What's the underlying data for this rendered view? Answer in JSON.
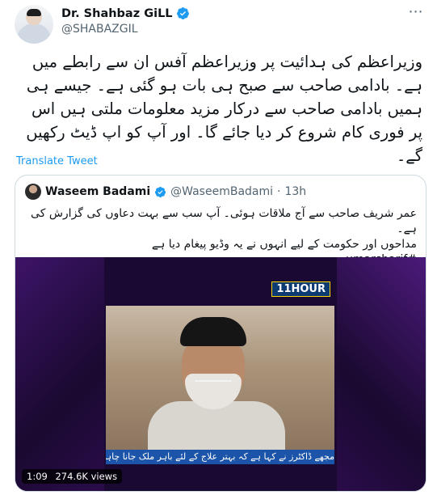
{
  "author": {
    "display_name": "Dr. Shahbaz GiLL",
    "handle": "@SHABAZGIL"
  },
  "tweet": {
    "text": "وزیراعظم کی ہدائیت پر وزیراعظم آفس ان سے رابطے میں ہے۔ بادامی صاحب سے صبح ہی بات ہو گئی ہے۔  جیسے ہی ہمیں بادامی صاحب سے درکار  مزید معلومات ملتی ہیں اس پر فوری کام شروع کر دیا جائے گا۔ اور آپ کو اپ ڈیٹ رکھیں گے۔",
    "translate_label": "Translate Tweet"
  },
  "quoted": {
    "display_name": "Waseem Badami",
    "handle": "@WaseemBadami",
    "separator": "·",
    "time": "13h",
    "text_line1": "عمر شریف صاحب سے آج ملاقات ہوئی۔ آپ سب سے بہت دعاوں کی گزارش کی ہے۔",
    "text_line2": "مداحوں اور حکومت کے لیے انہوں نے یہ وڈیو پیغام دیا ہے",
    "hashtag": "#umarsharif"
  },
  "video": {
    "duration": "1:09",
    "views": "274.6K views",
    "channel_logo": "11HOUR",
    "ticker": "مجھے ڈاکٹرز نے کہا ہے کہ بہتر علاج کے لئے باہر ملک جانا چاہیئے"
  },
  "colors": {
    "accent": "#1d9bf0",
    "secondary_text": "#536471",
    "border": "#cfd9de"
  },
  "icons": {
    "verified": "verified-badge-icon",
    "more": "more-options-icon"
  }
}
